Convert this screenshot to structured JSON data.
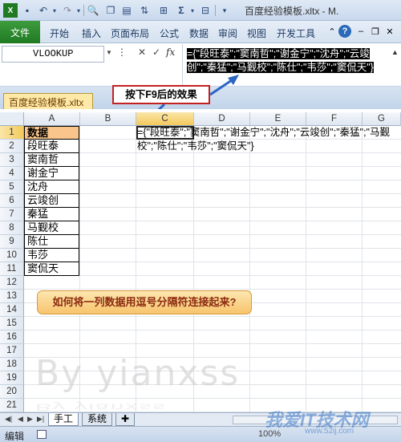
{
  "title_bar": {
    "title": "百度经验模板.xltx - M.",
    "icons": [
      "excel-icon",
      "save-icon",
      "undo-icon",
      "redo-icon",
      "print-preview-icon",
      "copy-icon",
      "borders-icon",
      "autosum-icon",
      "sort-icon",
      "more-icon"
    ]
  },
  "ribbon": {
    "file_label": "文件",
    "tabs": [
      "开始",
      "插入",
      "页面布局",
      "公式",
      "数据",
      "审阅",
      "视图",
      "开发工具"
    ]
  },
  "formula_bar": {
    "name_box": "VLOOKUP",
    "formula": "={\"段旺泰\";\"窦南哲\";\"谢金宁\";\"沈舟\";\"云竣创\";\"秦猛\";\"马觐校\";\"陈仕\";\"韦莎\";\"窦侃天\"}"
  },
  "workbook_tab": "百度经验模板.xltx",
  "callout_top": "按下F9后的效果",
  "columns": [
    "A",
    "B",
    "C",
    "D",
    "E",
    "F",
    "G"
  ],
  "rows": [
    "1",
    "2",
    "3",
    "4",
    "5",
    "6",
    "7",
    "8",
    "9",
    "10",
    "11",
    "12",
    "13",
    "14",
    "15",
    "16",
    "17",
    "18",
    "19",
    "20",
    "21"
  ],
  "column_a": {
    "header": "数据",
    "values": [
      "段旺泰",
      "窦南哲",
      "谢金宁",
      "沈舟",
      "云竣创",
      "秦猛",
      "马觐校",
      "陈仕",
      "韦莎",
      "窦侃天"
    ]
  },
  "cell_c1": "={\"段旺泰\";\"窦南哲\";\"谢金宁\";\"沈舟\";\"云竣创\";\"秦猛\";\"马觐校\";\"陈仕\";\"韦莎\";\"窦侃天\"}",
  "callout_question": "如何将一列数据用逗号分隔符连接起来?",
  "watermark": "By yianxss",
  "sheet_tabs": [
    "手工",
    "系统"
  ],
  "status": {
    "mode": "编辑",
    "zoom": "100%"
  },
  "site_watermark": "我爱IT技术网",
  "site_url": "www.52ij.com"
}
